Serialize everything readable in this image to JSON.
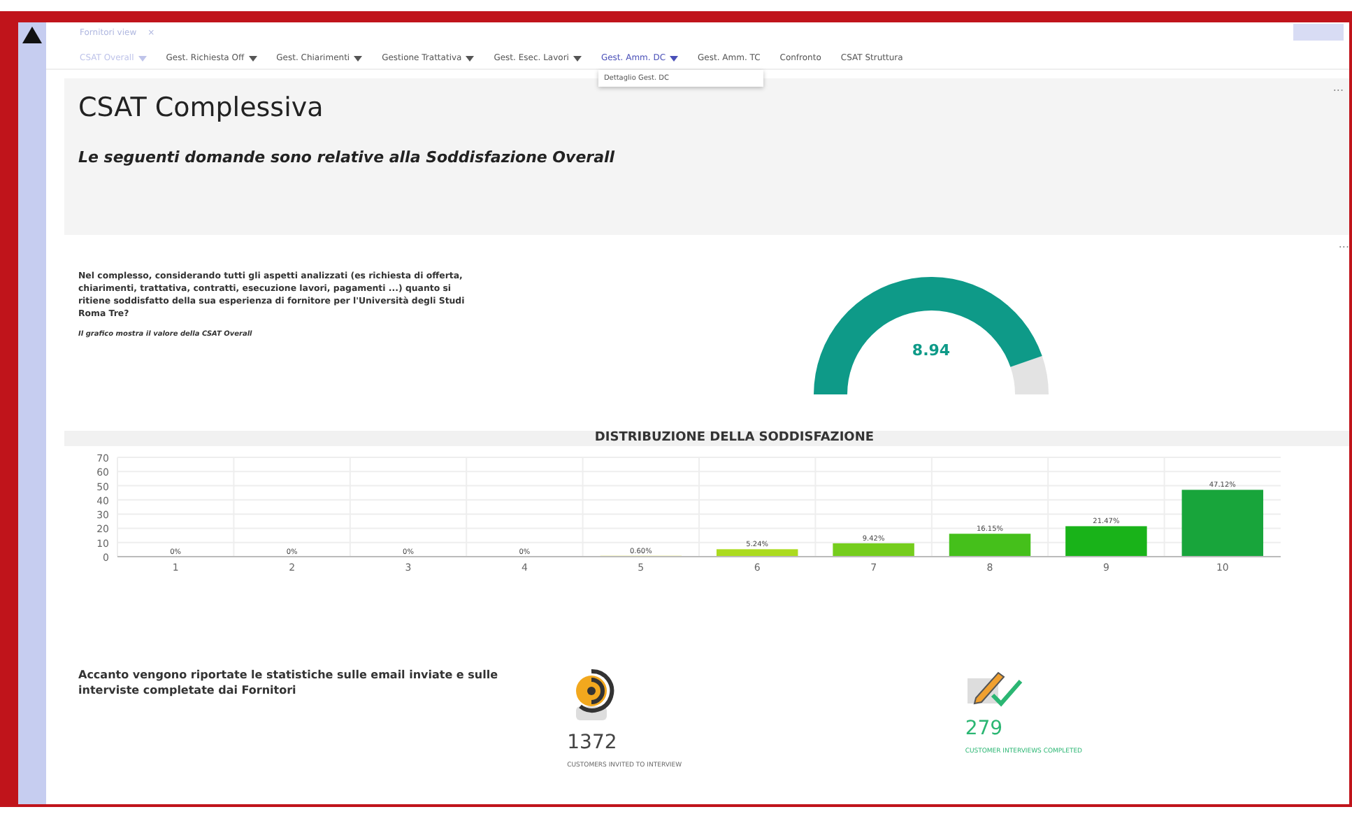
{
  "view_tab": {
    "label": "Fornitori view",
    "close": "×"
  },
  "nav": [
    {
      "label": "CSAT Overall",
      "dropdown": true,
      "selected": false,
      "disabled": true
    },
    {
      "label": "Gest. Richiesta Off",
      "dropdown": true,
      "selected": false,
      "disabled": false
    },
    {
      "label": "Gest. Chiarimenti",
      "dropdown": true,
      "selected": false,
      "disabled": false
    },
    {
      "label": "Gestione Trattativa",
      "dropdown": true,
      "selected": false,
      "disabled": false
    },
    {
      "label": "Gest. Esec. Lavori",
      "dropdown": true,
      "selected": false,
      "disabled": false
    },
    {
      "label": "Gest. Amm. DC",
      "dropdown": true,
      "selected": true,
      "disabled": false
    },
    {
      "label": "Gest. Amm. TC",
      "dropdown": false,
      "selected": false,
      "disabled": false
    },
    {
      "label": "Confronto",
      "dropdown": false,
      "selected": false,
      "disabled": false
    },
    {
      "label": "CSAT Struttura",
      "dropdown": false,
      "selected": false,
      "disabled": false
    }
  ],
  "dropdown_menu": {
    "items": [
      "Dettaglio Gest. DC"
    ]
  },
  "header": {
    "title": "CSAT Complessiva",
    "subtitle": "Le seguenti domande sono relative alla Soddisfazione Overall",
    "more": "..."
  },
  "question": {
    "text": "Nel complesso, considerando tutti gli aspetti analizzati (es richiesta di offerta, chiarimenti, trattativa, contratti, esecuzione lavori, pagamenti ...) quanto si ritiene soddisfatto della sua esperienza di fornitore per l'Università degli Studi Roma Tre?",
    "note": "Il grafico mostra il valore della CSAT Overall",
    "more": "..."
  },
  "gauge": {
    "value": "8.94"
  },
  "chart_data": {
    "type": "bar",
    "title": "DISTRIBUZIONE DELLA SODDISFAZIONE",
    "categories": [
      "1",
      "2",
      "3",
      "4",
      "5",
      "6",
      "7",
      "8",
      "9",
      "10"
    ],
    "values": [
      0,
      0,
      0,
      0,
      0.6,
      5.24,
      9.42,
      16.15,
      21.47,
      47.12
    ],
    "grid": true,
    "value_labels": [
      "0%",
      "0%",
      "0%",
      "0%",
      "0.60%",
      "5.24%",
      "9.42%",
      "16.15%",
      "21.47%",
      "47.12%"
    ],
    "ylim": [
      0,
      70
    ],
    "yticks": [
      0,
      10,
      20,
      30,
      40,
      50,
      60,
      70
    ]
  },
  "stats": {
    "text": "Accanto vengono riportate le statistiche sulle email inviate e sulle interviste completate dai Fornitori",
    "items": [
      {
        "kind": "invited",
        "value": "1372",
        "label": "CUSTOMERS INVITED TO INTERVIEW"
      },
      {
        "kind": "completed",
        "value": "279",
        "label": "CUSTOMER INTERVIEWS COMPLETED"
      }
    ]
  }
}
